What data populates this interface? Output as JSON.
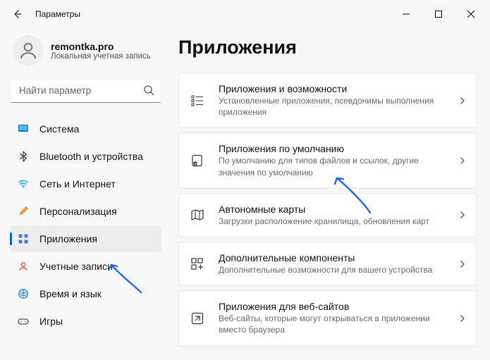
{
  "window": {
    "title": "Параметры"
  },
  "account": {
    "name": "remontka.pro",
    "sub": "Локальная учетная запись"
  },
  "search": {
    "placeholder": "Найти параметр"
  },
  "sidebar": {
    "items": [
      {
        "label": "Система"
      },
      {
        "label": "Bluetooth и устройства"
      },
      {
        "label": "Сеть и Интернет"
      },
      {
        "label": "Персонализация"
      },
      {
        "label": "Приложения"
      },
      {
        "label": "Учетные записи"
      },
      {
        "label": "Время и язык"
      },
      {
        "label": "Игры"
      }
    ]
  },
  "main": {
    "title": "Приложения",
    "cards": [
      {
        "title": "Приложения и возможности",
        "sub": "Установленные приложения, псевдонимы выполнения приложения"
      },
      {
        "title": "Приложения по умолчанию",
        "sub": "По умолчанию для типов файлов и ссылок, другие значения по умолчанию"
      },
      {
        "title": "Автономные карты",
        "sub": "Загрузки расположение хранилища, обновления карт"
      },
      {
        "title": "Дополнительные компоненты",
        "sub": "Дополнительные возможности для вашего устройства"
      },
      {
        "title": "Приложения для веб-сайтов",
        "sub": "Веб-сайты, которые могут открываться в приложении вместо браузера"
      }
    ]
  }
}
